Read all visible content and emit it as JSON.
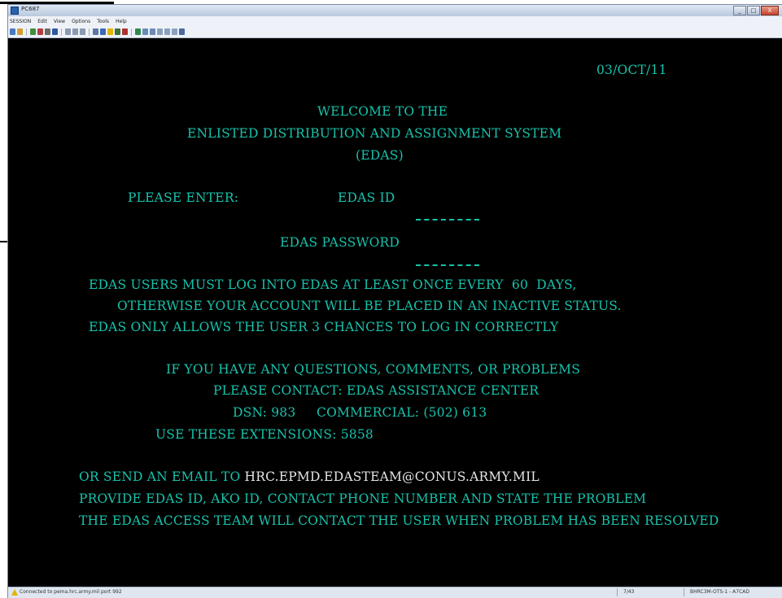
{
  "window": {
    "title": "PC687",
    "menu": [
      "SESSION",
      "Edit",
      "View",
      "Options",
      "Tools",
      "Help"
    ],
    "controls": [
      "_",
      "□",
      "X"
    ]
  },
  "terminal": {
    "date": "03/OCT/11",
    "welcome_line1": "WELCOME TO THE",
    "welcome_line2": "ENLISTED DISTRIBUTION AND ASSIGNMENT SYSTEM",
    "welcome_line3": "(EDAS)",
    "please_enter": "PLEASE ENTER:",
    "id_label": "EDAS ID",
    "password_label": "EDAS PASSWORD",
    "notice_line1": "EDAS USERS MUST LOG INTO EDAS AT LEAST ONCE EVERY  60  DAYS,",
    "notice_line2": "OTHERWISE YOUR ACCOUNT WILL BE PLACED IN AN INACTIVE STATUS.",
    "notice_line3": "EDAS ONLY ALLOWS THE USER 3 CHANCES TO LOG IN CORRECTLY",
    "help_line1": "IF YOU HAVE ANY QUESTIONS, COMMENTS, OR PROBLEMS",
    "help_line2": "PLEASE CONTACT: EDAS ASSISTANCE CENTER",
    "help_line3": "DSN: 983     COMMERCIAL: (502) 613",
    "help_line4": "USE THESE EXTENSIONS: 5858",
    "email_prefix": "OR SEND AN EMAIL TO ",
    "email_address": "HRC.EPMD.EDASTEAM@CONUS.ARMY.MIL",
    "provide_line": "PROVIDE EDAS ID, AKO ID, CONTACT PHONE NUMBER AND STATE THE PROBLEM",
    "access_line": "THE EDAS ACCESS TEAM WILL CONTACT THE USER WHEN PROBLEM HAS BEEN RESOLVED"
  },
  "status_bar": {
    "connection": "Connected to pema.hrc.army.mil port 992",
    "cursor": "7/43",
    "session": "BHRC3M-OTS-1 - A7CAD"
  },
  "colors": {
    "terminal_text": "#17c3ac",
    "terminal_bg": "#000000",
    "highlight_text": "#e6e6e6"
  }
}
